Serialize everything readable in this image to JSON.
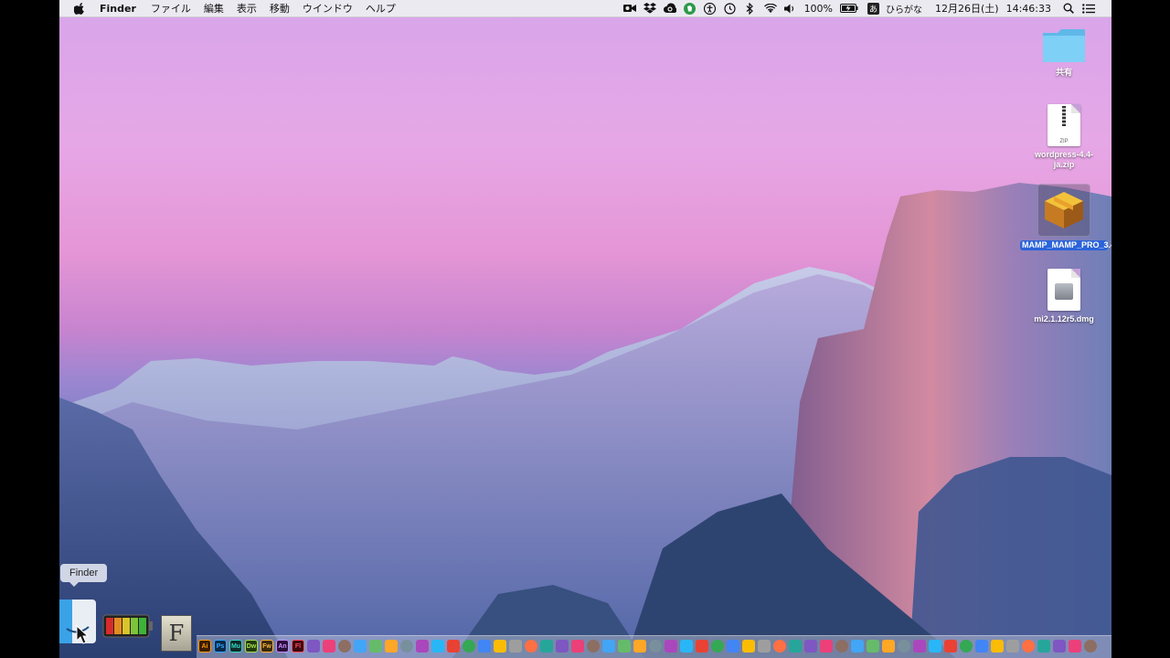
{
  "menubar": {
    "app_name": "Finder",
    "items": [
      "ファイル",
      "編集",
      "表示",
      "移動",
      "ウインドウ",
      "ヘルプ"
    ],
    "battery_percent": "100%",
    "input_method": "ひらがな",
    "input_method_glyph": "あ",
    "date": "12月26日(土)",
    "time": "14:46:33"
  },
  "desktop": {
    "items": [
      {
        "label": "共有",
        "icon": "folder-icon"
      },
      {
        "label": "wordpress-4.4-ja.zip",
        "icon": "zip-file-icon",
        "badge": "ZIP"
      },
      {
        "label": "MAMP_MAMP_PRO_3.4.pkg",
        "icon": "package-icon",
        "selected": true
      },
      {
        "label": "mi2.1.12r5.dmg",
        "icon": "disk-image-icon"
      }
    ]
  },
  "dock": {
    "tooltip": "Finder",
    "app_labels": [
      "Ai",
      "Ps",
      "Mu",
      "Dw",
      "Fw",
      "An",
      "Fl"
    ],
    "font_icon_letter": "F"
  },
  "colors": {
    "selection": "#2b63d9",
    "folder": "#6cc7f2",
    "battery_fill": "#d62b2b"
  }
}
